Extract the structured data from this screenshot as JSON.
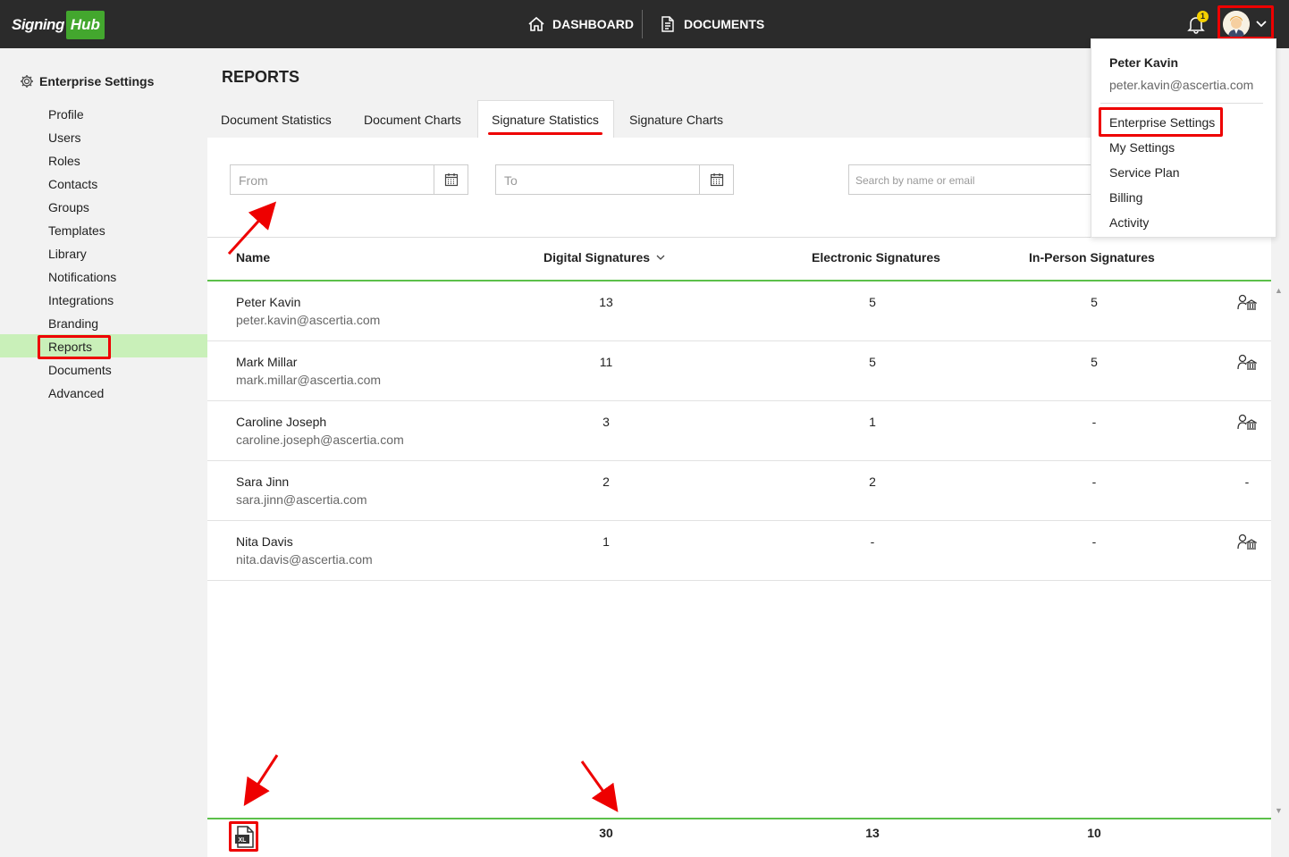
{
  "topbar": {
    "logo_signing": "Signing",
    "logo_hub": "Hub",
    "dashboard_label": "DASHBOARD",
    "documents_label": "DOCUMENTS",
    "notification_count": "1"
  },
  "sidebar": {
    "title": "Enterprise Settings",
    "items": [
      {
        "label": "Profile"
      },
      {
        "label": "Users"
      },
      {
        "label": "Roles"
      },
      {
        "label": "Contacts"
      },
      {
        "label": "Groups"
      },
      {
        "label": "Templates"
      },
      {
        "label": "Library"
      },
      {
        "label": "Notifications"
      },
      {
        "label": "Integrations"
      },
      {
        "label": "Branding"
      },
      {
        "label": "Reports"
      },
      {
        "label": "Documents"
      },
      {
        "label": "Advanced"
      }
    ],
    "active": "Reports"
  },
  "main": {
    "title": "REPORTS",
    "tabs": [
      {
        "label": "Document Statistics"
      },
      {
        "label": "Document Charts"
      },
      {
        "label": "Signature Statistics"
      },
      {
        "label": "Signature Charts"
      }
    ],
    "active_tab": "Signature Statistics",
    "filters": {
      "from_placeholder": "From",
      "to_placeholder": "To",
      "search_placeholder": "Search by name or email"
    },
    "table": {
      "columns": [
        "Name",
        "Digital Signatures",
        "Electronic Signatures",
        "In-Person Signatures"
      ],
      "rows": [
        {
          "name": "Peter Kavin",
          "email": "peter.kavin@ascertia.com",
          "digital": "13",
          "electronic": "5",
          "inperson": "5",
          "action": "icon"
        },
        {
          "name": "Mark Millar",
          "email": "mark.millar@ascertia.com",
          "digital": "11",
          "electronic": "5",
          "inperson": "5",
          "action": "icon"
        },
        {
          "name": "Caroline Joseph",
          "email": "caroline.joseph@ascertia.com",
          "digital": "3",
          "electronic": "1",
          "inperson": "-",
          "action": "icon"
        },
        {
          "name": "Sara Jinn",
          "email": "sara.jinn@ascertia.com",
          "digital": "2",
          "electronic": "2",
          "inperson": "-",
          "action": "-"
        },
        {
          "name": "Nita Davis",
          "email": "nita.davis@ascertia.com",
          "digital": "1",
          "electronic": "-",
          "inperson": "-",
          "action": "icon"
        }
      ],
      "totals": {
        "digital": "30",
        "electronic": "13",
        "inperson": "10"
      }
    }
  },
  "user_menu": {
    "name": "Peter Kavin",
    "email": "peter.kavin@ascertia.com",
    "items": [
      {
        "label": "Enterprise Settings"
      },
      {
        "label": "My Settings"
      },
      {
        "label": "Service Plan"
      },
      {
        "label": "Billing"
      },
      {
        "label": "Activity"
      }
    ]
  },
  "colors": {
    "topbar": "#2b2b2b",
    "brand_green": "#43a72e",
    "active_bg": "#c9f0b9",
    "accent_line": "#5cc04a",
    "highlight_red": "#e00000"
  }
}
